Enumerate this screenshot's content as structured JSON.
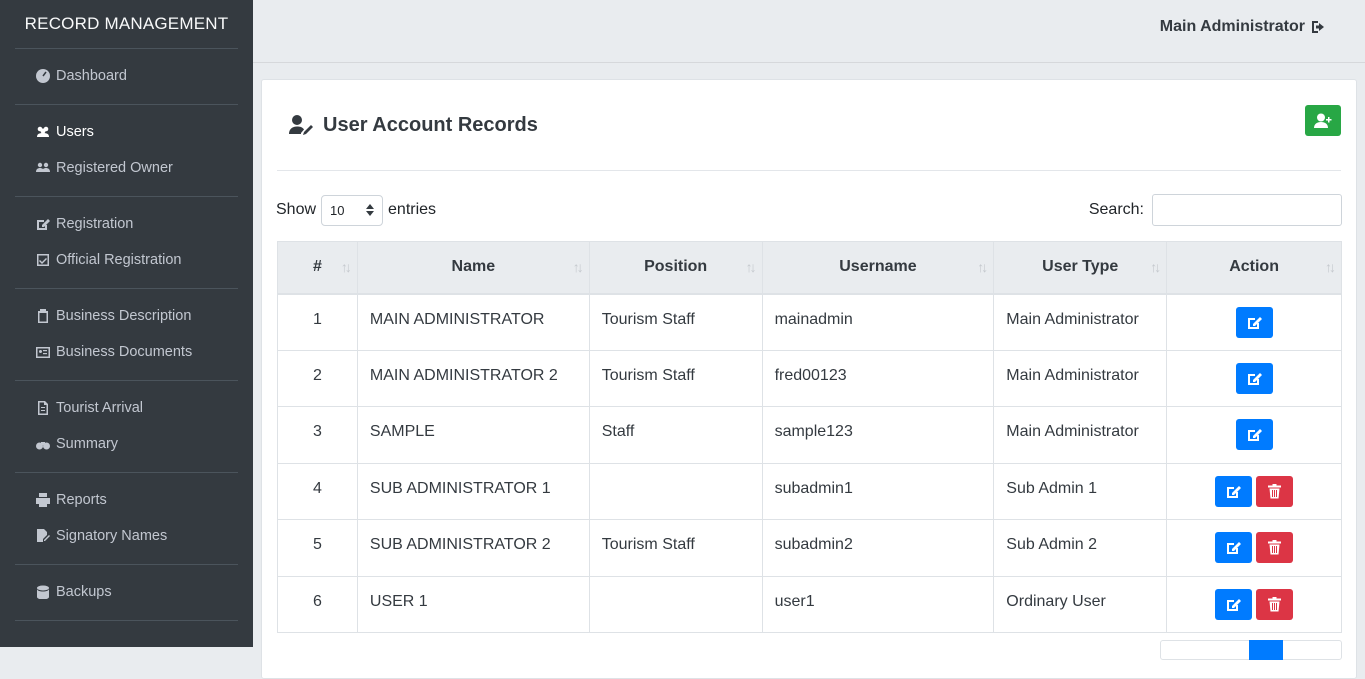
{
  "brand": "RECORD MANAGEMENT",
  "sidebar": {
    "groups": [
      [
        {
          "label": "Dashboard",
          "icon": "tachometer-icon"
        }
      ],
      [
        {
          "label": "Users",
          "icon": "users-icon",
          "active": true
        },
        {
          "label": "Registered Owner",
          "icon": "users-cog-icon"
        }
      ],
      [
        {
          "label": "Registration",
          "icon": "edit-icon"
        },
        {
          "label": "Official Registration",
          "icon": "check-square-icon"
        }
      ],
      [
        {
          "label": "Business Description",
          "icon": "clipboard-icon"
        },
        {
          "label": "Business Documents",
          "icon": "id-card-icon"
        }
      ],
      [
        {
          "label": "Tourist Arrival",
          "icon": "file-icon"
        },
        {
          "label": "Summary",
          "icon": "binoculars-icon"
        }
      ],
      [
        {
          "label": "Reports",
          "icon": "print-icon"
        },
        {
          "label": "Signatory Names",
          "icon": "file-signature-icon"
        }
      ],
      [
        {
          "label": "Backups",
          "icon": "database-icon"
        }
      ]
    ]
  },
  "topbar": {
    "user": "Main Administrator"
  },
  "card": {
    "title": "User Account Records"
  },
  "controls": {
    "show": "Show",
    "entries_value": "10",
    "entries": "entries",
    "search": "Search:"
  },
  "table": {
    "headers": [
      "#",
      "Name",
      "Position",
      "Username",
      "User Type",
      "Action"
    ],
    "rows": [
      {
        "num": "1",
        "name": "MAIN ADMINISTRATOR",
        "position": "Tourism Staff",
        "username": "mainadmin",
        "type": "Main Administrator",
        "delete": false
      },
      {
        "num": "2",
        "name": "MAIN ADMINISTRATOR 2",
        "position": "Tourism Staff",
        "username": "fred00123",
        "type": "Main Administrator",
        "delete": false
      },
      {
        "num": "3",
        "name": "SAMPLE",
        "position": "Staff",
        "username": "sample123",
        "type": "Main Administrator",
        "delete": false
      },
      {
        "num": "4",
        "name": "SUB ADMINISTRATOR 1",
        "position": "",
        "username": "subadmin1",
        "type": "Sub Admin 1",
        "delete": true
      },
      {
        "num": "5",
        "name": "SUB ADMINISTRATOR 2",
        "position": "Tourism Staff",
        "username": "subadmin2",
        "type": "Sub Admin 2",
        "delete": true
      },
      {
        "num": "6",
        "name": "USER 1",
        "position": "",
        "username": "user1",
        "type": "Ordinary User",
        "delete": true
      }
    ]
  },
  "colors": {
    "sidebar": "#343a40",
    "edit": "#007bff",
    "delete": "#dc3545",
    "add": "#28a745"
  }
}
